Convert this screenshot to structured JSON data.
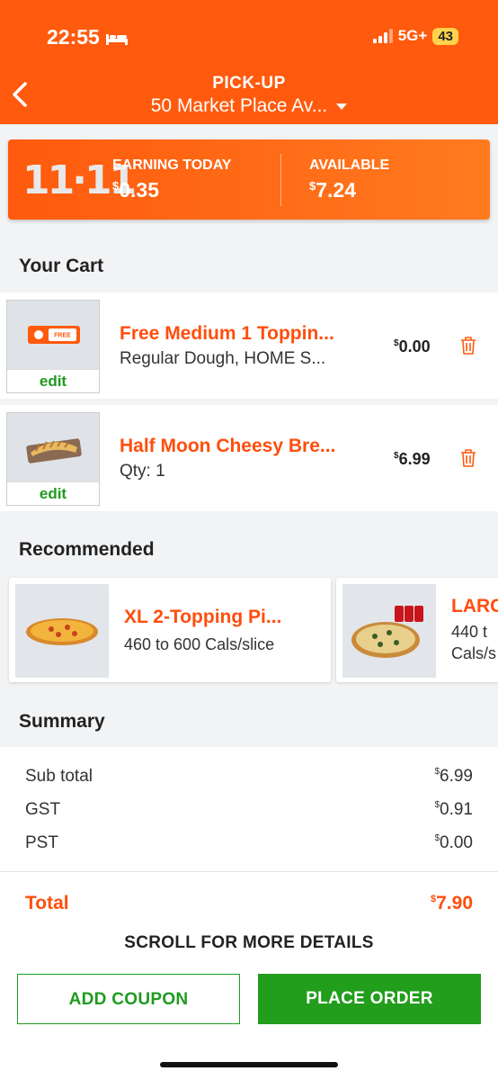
{
  "status_bar": {
    "time": "22:55",
    "network": "5G+",
    "battery": "43"
  },
  "header": {
    "title": "PICK-UP",
    "address": "50 Market Place Av..."
  },
  "earnings": {
    "logo": "11·11",
    "earning_label": "EARNING TODAY",
    "earning_currency": "$",
    "earning_value": "0.35",
    "available_label": "AVAILABLE",
    "available_currency": "$",
    "available_value": "7.24"
  },
  "cart": {
    "title": "Your Cart",
    "items": [
      {
        "name": "Free Medium 1 Toppin...",
        "detail": "Regular Dough, HOME S...",
        "currency": "$",
        "price": "0.00",
        "edit_label": "edit",
        "thumb_badge": "FREE"
      },
      {
        "name": "Half Moon Cheesy Bre...",
        "detail": "Qty: 1",
        "currency": "$",
        "price": "6.99",
        "edit_label": "edit"
      }
    ]
  },
  "recommended": {
    "title": "Recommended",
    "items": [
      {
        "name": "XL 2-Topping Pi...",
        "detail": "460 to 600 Cals/slice"
      },
      {
        "name": "LARG",
        "detail_line1": "440 t",
        "detail_line2": "Cals/s"
      }
    ]
  },
  "summary": {
    "title": "Summary",
    "rows": [
      {
        "label": "Sub total",
        "currency": "$",
        "value": "6.99"
      },
      {
        "label": "GST",
        "currency": "$",
        "value": "0.91"
      },
      {
        "label": "PST",
        "currency": "$",
        "value": "0.00"
      }
    ],
    "total_label": "Total",
    "total_currency": "$",
    "total_value": "7.90"
  },
  "scroll_hint": "SCROLL FOR MORE DETAILS",
  "buttons": {
    "coupon": "ADD COUPON",
    "order": "PLACE ORDER"
  },
  "colors": {
    "brand_orange": "#ff5a0d",
    "accent_green": "#229d1c"
  }
}
